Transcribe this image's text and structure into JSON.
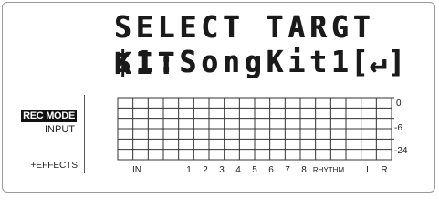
{
  "display": {
    "line1": "SELECT TARGT KIT",
    "line2": "$1:SongKit1",
    "enter_symbol": "[↵]"
  },
  "side": {
    "rec_mode": "REC MODE",
    "input": "INPUT",
    "effects": "+EFFECTS"
  },
  "meter": {
    "db_labels": [
      "0",
      "-6",
      "-24"
    ],
    "channels": [
      "IN",
      "1",
      "2",
      "3",
      "4",
      "5",
      "6",
      "7",
      "8",
      "RHYTHM",
      "L",
      "R"
    ]
  }
}
